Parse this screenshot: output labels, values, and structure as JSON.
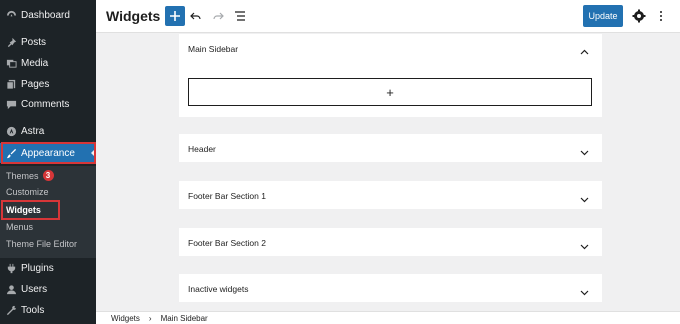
{
  "sidebar": {
    "items": [
      {
        "label": "Dashboard",
        "icon": "dashboard-icon"
      },
      {
        "label": "Posts",
        "icon": "pin-icon"
      },
      {
        "label": "Media",
        "icon": "media-icon"
      },
      {
        "label": "Pages",
        "icon": "pages-icon"
      },
      {
        "label": "Comments",
        "icon": "comments-icon"
      },
      {
        "label": "Astra",
        "icon": "astra-icon"
      },
      {
        "label": "Appearance",
        "icon": "brush-icon"
      },
      {
        "label": "Plugins",
        "icon": "plugin-icon"
      },
      {
        "label": "Users",
        "icon": "users-icon"
      },
      {
        "label": "Tools",
        "icon": "tools-icon"
      }
    ],
    "submenu": [
      {
        "label": "Themes",
        "badge": "3"
      },
      {
        "label": "Customize"
      },
      {
        "label": "Widgets"
      },
      {
        "label": "Menus"
      },
      {
        "label": "Theme File Editor"
      }
    ]
  },
  "header": {
    "title": "Widgets",
    "update_label": "Update"
  },
  "panels": [
    {
      "label": "Main Sidebar",
      "expanded": true,
      "add_symbol": "+"
    },
    {
      "label": "Header",
      "expanded": false
    },
    {
      "label": "Footer Bar Section 1",
      "expanded": false
    },
    {
      "label": "Footer Bar Section 2",
      "expanded": false
    },
    {
      "label": "Inactive widgets",
      "expanded": false
    }
  ],
  "breadcrumb": {
    "items": [
      "Widgets",
      "Main Sidebar"
    ],
    "separator": "›"
  },
  "colors": {
    "sidebar_bg": "#1d2327",
    "accent": "#2271b1",
    "highlight": "#d63638"
  }
}
